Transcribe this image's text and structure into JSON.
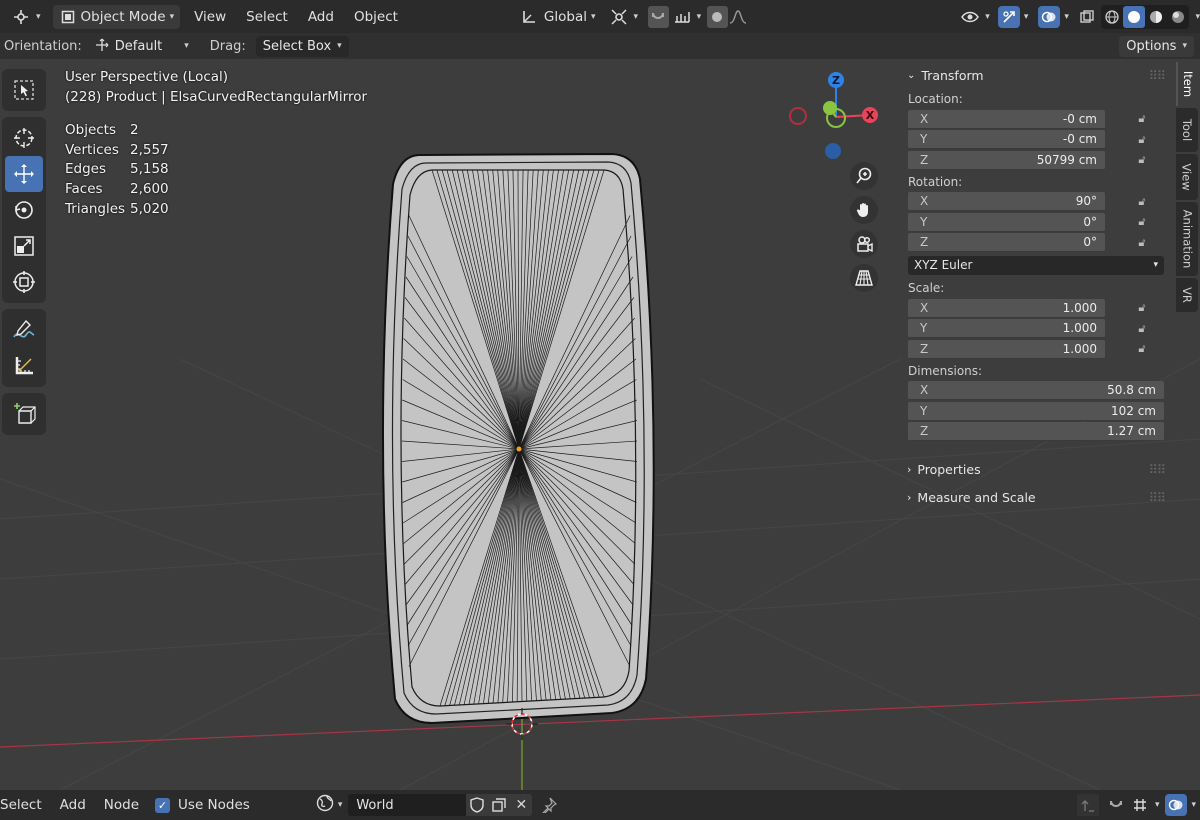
{
  "header": {
    "mode_label": "Object Mode",
    "menus": [
      "View",
      "Select",
      "Add",
      "Object"
    ],
    "transform_orientation": "Global"
  },
  "toolsettings": {
    "orientation_label": "Orientation:",
    "orientation_value": "Default",
    "drag_label": "Drag:",
    "drag_value": "Select Box",
    "options_label": "Options"
  },
  "viewport": {
    "perspective": "User Perspective (Local)",
    "object_info": "(228) Product | ElsaCurvedRectangularMirror",
    "stats": [
      {
        "label": "Objects",
        "value": "2"
      },
      {
        "label": "Vertices",
        "value": "2,557"
      },
      {
        "label": "Edges",
        "value": "5,158"
      },
      {
        "label": "Faces",
        "value": "2,600"
      },
      {
        "label": "Triangles",
        "value": "5,020"
      }
    ],
    "gizmo": {
      "x": "X",
      "y": "Y",
      "z": "Z"
    }
  },
  "npanel": {
    "transform_title": "Transform",
    "location_label": "Location:",
    "location": [
      {
        "axis": "X",
        "value": "-0 cm"
      },
      {
        "axis": "Y",
        "value": "-0 cm"
      },
      {
        "axis": "Z",
        "value": "50799 cm"
      }
    ],
    "rotation_label": "Rotation:",
    "rotation": [
      {
        "axis": "X",
        "value": "90°"
      },
      {
        "axis": "Y",
        "value": "0°"
      },
      {
        "axis": "Z",
        "value": "0°"
      }
    ],
    "rotation_mode": "XYZ Euler",
    "scale_label": "Scale:",
    "scale": [
      {
        "axis": "X",
        "value": "1.000"
      },
      {
        "axis": "Y",
        "value": "1.000"
      },
      {
        "axis": "Z",
        "value": "1.000"
      }
    ],
    "dimensions_label": "Dimensions:",
    "dimensions": [
      {
        "axis": "X",
        "value": "50.8 cm"
      },
      {
        "axis": "Y",
        "value": "102 cm"
      },
      {
        "axis": "Z",
        "value": "1.27 cm"
      }
    ],
    "properties_title": "Properties",
    "measure_title": "Measure and Scale"
  },
  "sidebar_tabs": [
    "Item",
    "Tool",
    "View",
    "Animation",
    "VR"
  ],
  "bottom": {
    "select": "Select",
    "add": "Add",
    "node": "Node",
    "use_nodes": "Use Nodes",
    "world": "World"
  },
  "colors": {
    "accent": "#4772b3",
    "axis_x": "#e8445b",
    "axis_y": "#8bc53f",
    "axis_z": "#2f83e8"
  }
}
